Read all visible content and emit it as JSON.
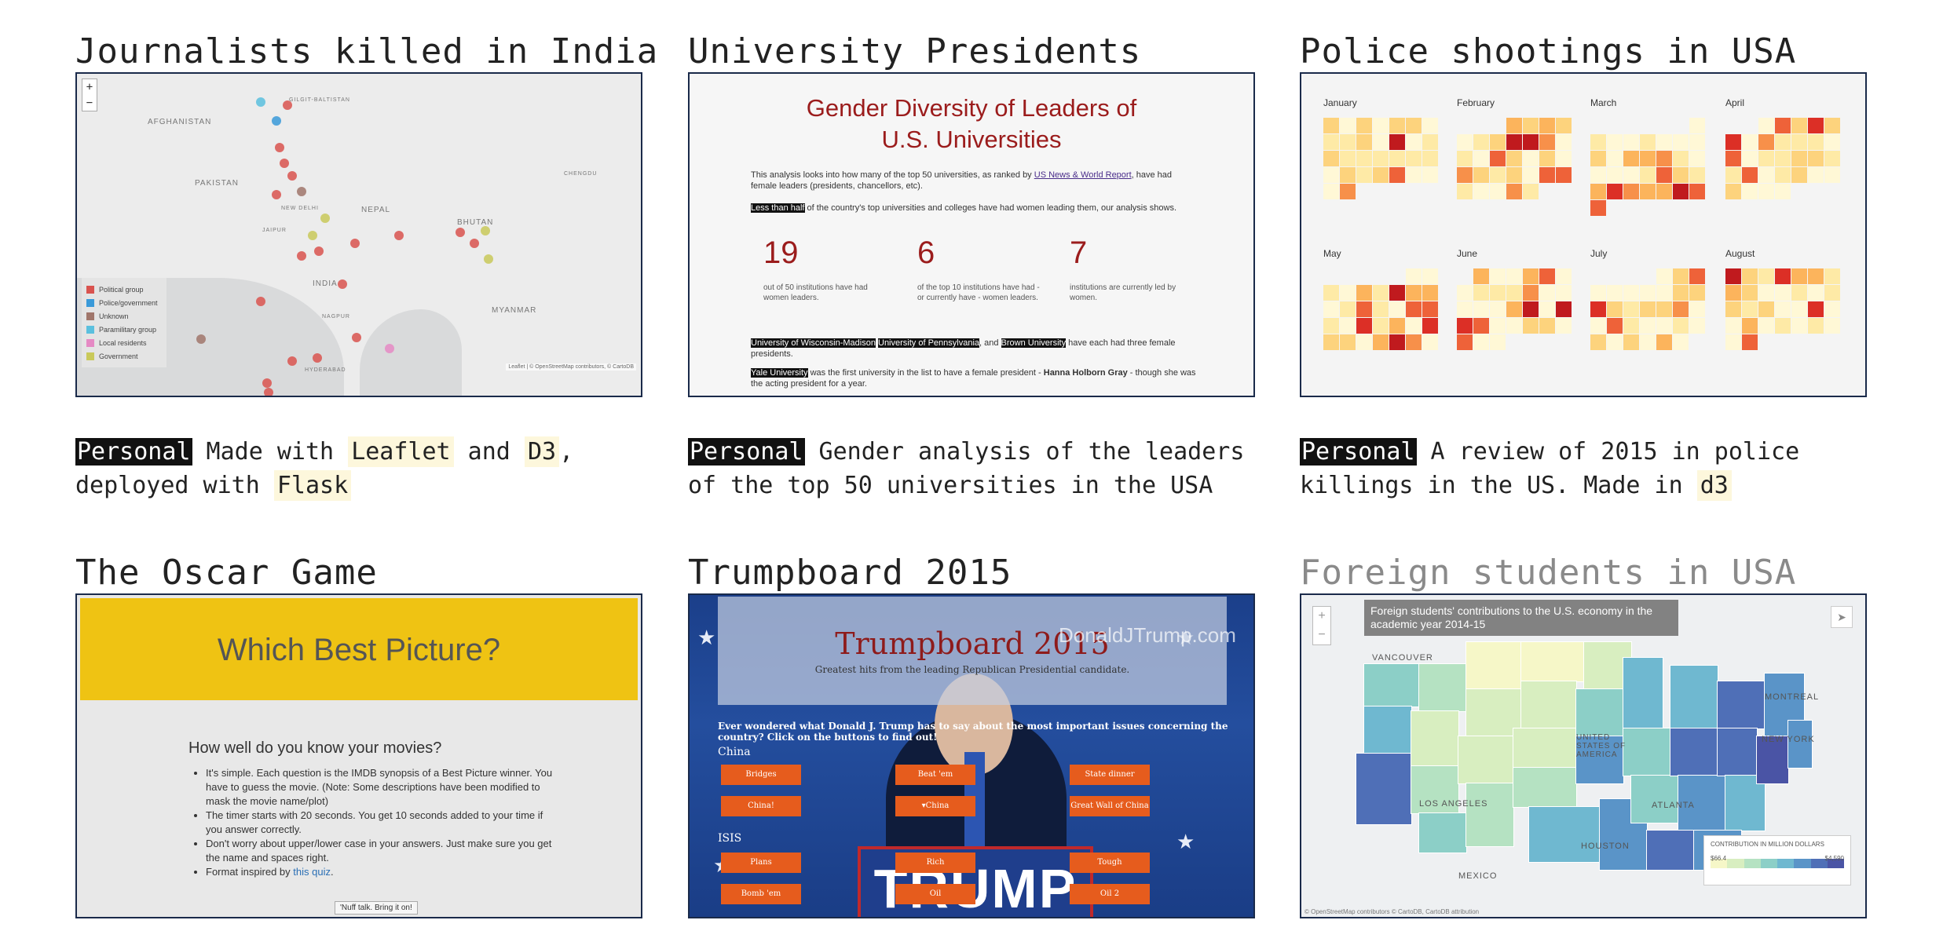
{
  "projects": [
    {
      "title": "Journalists killed in India",
      "tag": "Personal",
      "desc_parts": [
        " Made with ",
        " and ",
        ",",
        " deployed with "
      ],
      "tech": [
        "Leaflet",
        "D3",
        "Flask"
      ],
      "thumb": {
        "legend": [
          "Political group",
          "Police/government",
          "Unknown",
          "Paramilitary group",
          "Local residents",
          "Government"
        ],
        "legend_colors": [
          "#d9534f",
          "#3a9ad9",
          "#a0766b",
          "#5bc0de",
          "#e58ac4",
          "#c9c95a"
        ],
        "labels": [
          "AFGHANISTAN",
          "PAKISTAN",
          "NEPAL",
          "BHUTAN",
          "INDIA",
          "MYANMAR",
          "NEW DELHI",
          "JAIPUR",
          "NAGPUR",
          "HYDERABAD",
          "GILGIT-BALTISTAN",
          "CHENGDU"
        ],
        "attribution": "Leaflet | © OpenStreetMap contributors, © CartoDB"
      }
    },
    {
      "title": "University Presidents",
      "tag": "Personal",
      "desc": " Gender analysis of the leaders of the top 50 universities in the USA",
      "thumb": {
        "heading_1": "Gender Diversity of Leaders of",
        "heading_2": "U.S. Universities",
        "p1_a": "This analysis looks into how many of the top 50 universities, as ranked by ",
        "p1_link": "US News & World Report",
        "p1_b": ", have had female leaders (presidents, chancellors, etc).",
        "p2_hl": "Less than half",
        "p2_b": " of the country's top universities and colleges have had women leading them, our analysis shows.",
        "stats": [
          {
            "num": "19",
            "text": "out of 50 institutions have had women leaders."
          },
          {
            "num": "6",
            "text": "of the top 10 institutions have had - or currently have - women leaders."
          },
          {
            "num": "7",
            "text": "institutions are currently led by women."
          }
        ],
        "p3_h1": "University of Wisconsin-Madison",
        "p3_h2": "University of Pennsylvania",
        "p3_and": ", and ",
        "p3_h3": "Brown University",
        "p3_b": " have each had three female presidents.",
        "p4_hl": "Yale University",
        "p4_b": " was the first university in the list to have a female president - ",
        "p4_name": "Hanna Holborn Gray",
        "p4_c": " - though she was the acting president for a year."
      }
    },
    {
      "title": "Police shootings in USA",
      "tag": "Personal",
      "desc_a": " A review of 2015 in police killings in the US. Made in ",
      "tech": [
        "d3"
      ],
      "thumb": {
        "months": [
          "January",
          "February",
          "March",
          "April",
          "May",
          "June",
          "July",
          "August"
        ]
      }
    },
    {
      "title": "The Oscar Game",
      "thumb": {
        "heading": "Which Best Picture?",
        "sub": "How well do you know your movies?",
        "bullets": [
          "It's simple. Each question is the IMDB synopsis of a Best Picture winner. You have to guess the movie. (Note: Some descriptions have been modified to mask the movie name/plot)",
          "The timer starts with 20 seconds. You get 10 seconds added to your time if you answer correctly.",
          "Don't worry about upper/lower case in your answers. Just make sure you get the name and spaces right."
        ],
        "bullet_last_a": "Format inspired by ",
        "bullet_last_link": "this quiz",
        "bullet_last_b": ".",
        "button": "'Nuff talk. Bring it on!"
      }
    },
    {
      "title": "Trumpboard 2015",
      "thumb": {
        "heading": "Trumpboard 2015",
        "sub": "Greatest hits from the leading Republican Presidential candidate.",
        "question": "Ever wondered what Donald J. Trump has to say about the most important issues concerning the country? Click on the buttons to find out!",
        "sections": [
          "China",
          "ISIS"
        ],
        "china_buttons": [
          "Bridges",
          "Beat 'em",
          "State dinner",
          "China!",
          "▾China",
          "Great Wall of China"
        ],
        "isis_buttons": [
          "Plans",
          "Rich",
          "Tough",
          "Bomb 'em",
          "Oil",
          "Oil 2"
        ],
        "sign": "TRUMP",
        "watermark": "DonaldJTrump.com"
      }
    },
    {
      "title": "Foreign students in USA",
      "thumb": {
        "title": "Foreign students' contributions to the U.S. economy in the academic year 2014-15",
        "legend_title": "CONTRIBUTION IN MILLION DOLLARS",
        "legend_min": "$66.4",
        "legend_max": "$4,590",
        "labels": [
          "VANCOUVER",
          "UNITED STATES OF AMERICA",
          "MONTREAL",
          "NEW YORK",
          "LOS ANGELES",
          "MEXICO",
          "ATLANTA",
          "HOUSTON"
        ],
        "ramp": [
          "#f6f7c8",
          "#d8eec0",
          "#b5e2c2",
          "#8ccfc7",
          "#6fb8d0",
          "#5a94c8",
          "#4f6fb7",
          "#4a54a5"
        ],
        "attribution": "© OpenStreetMap contributors © CartoDB, CartoDB attribution"
      }
    }
  ]
}
